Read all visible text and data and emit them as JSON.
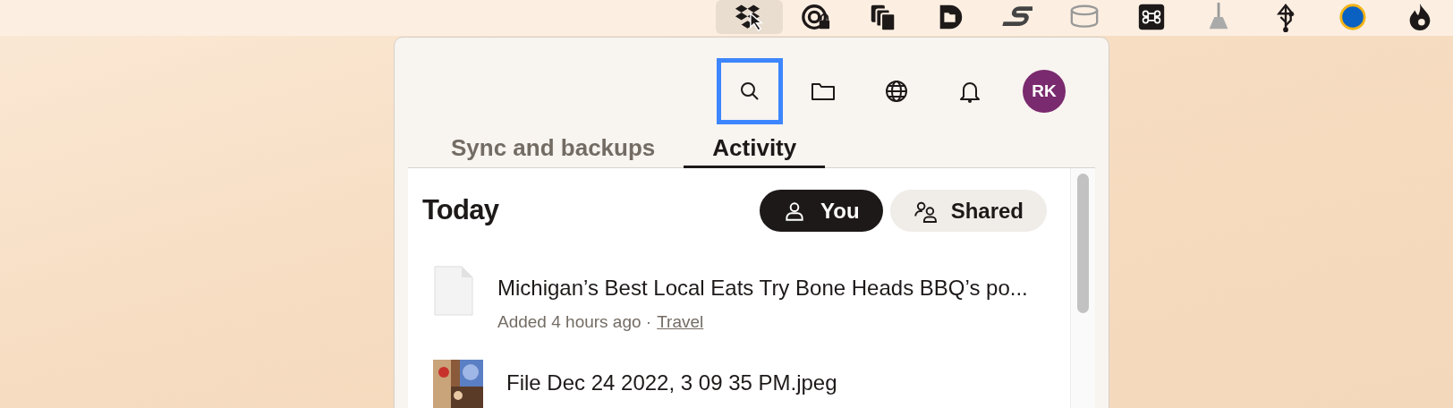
{
  "menu_bar": {
    "items": [
      {
        "kind": "box",
        "selected": true
      },
      {
        "kind": "at-lock",
        "selected": false
      },
      {
        "kind": "copies",
        "selected": false
      },
      {
        "kind": "d-folder",
        "selected": false
      },
      {
        "kind": "s-mark",
        "selected": false
      },
      {
        "kind": "cylinder",
        "selected": false
      },
      {
        "kind": "command",
        "selected": false
      },
      {
        "kind": "broom",
        "selected": false
      },
      {
        "kind": "usb",
        "selected": false
      },
      {
        "kind": "circle",
        "selected": false
      },
      {
        "kind": "flame",
        "selected": false
      }
    ]
  },
  "header": {
    "buttons": [
      {
        "kind": "search",
        "focused": true
      },
      {
        "kind": "folder",
        "focused": false
      },
      {
        "kind": "globe",
        "focused": false
      },
      {
        "kind": "bell",
        "focused": false
      }
    ],
    "avatar": {
      "initials": "RK",
      "color": "#7a2a6e"
    }
  },
  "tabs": [
    {
      "label": "Sync and backups",
      "selected": false
    },
    {
      "label": "Activity",
      "selected": true
    }
  ],
  "section": {
    "title": "Today"
  },
  "filters": [
    {
      "label": "You",
      "kind": "person",
      "selected": true
    },
    {
      "label": "Shared",
      "kind": "people",
      "selected": false
    }
  ],
  "activity": [
    {
      "kind": "document",
      "title": "Michigan’s Best Local Eats Try Bone Heads BBQ’s po...",
      "meta": "Added 4 hours ago ·",
      "folder": "Travel"
    },
    {
      "kind": "picture",
      "title": "File Dec 24 2022, 3 09 35 PM.jpeg"
    }
  ]
}
